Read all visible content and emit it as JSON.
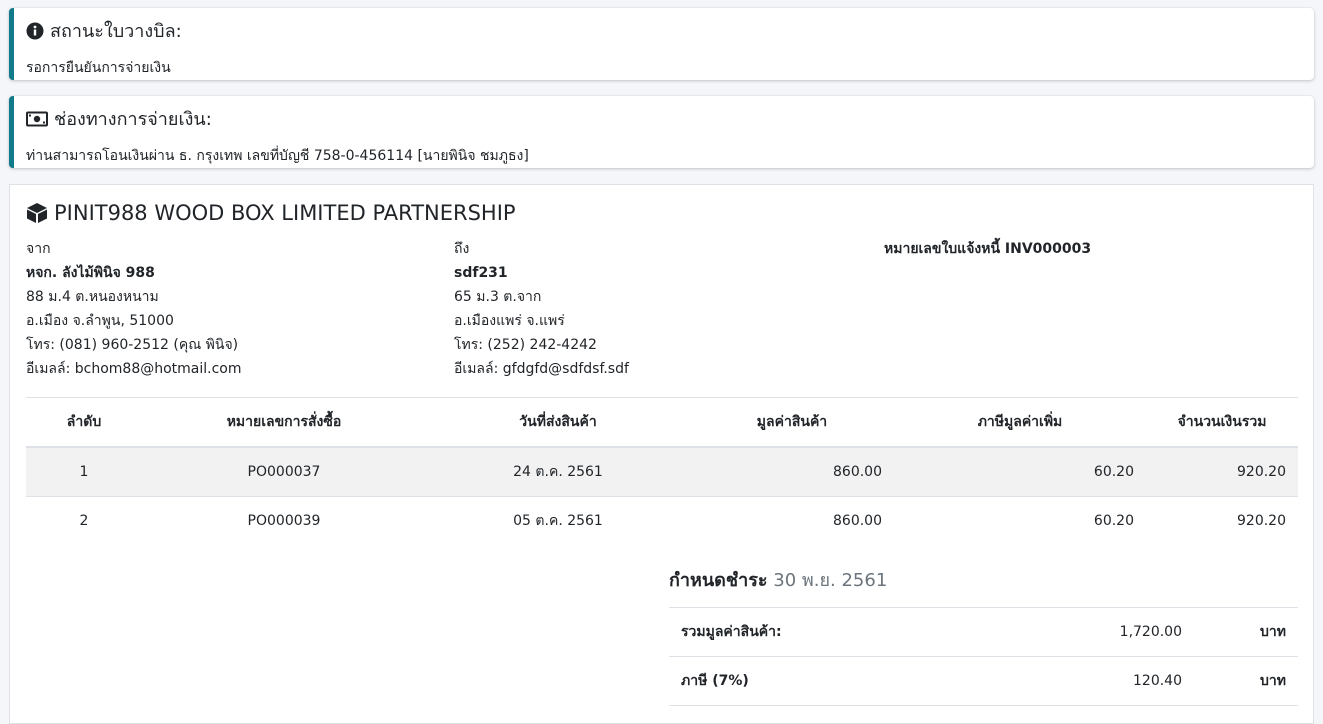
{
  "status": {
    "icon": "info-circle-icon",
    "title": "สถานะใบวางบิล:",
    "text": "รอการยืนยันการจ่ายเงิน"
  },
  "payment": {
    "icon": "money-bill-icon",
    "title": "ช่องทางการจ่ายเงิน:",
    "text": "ท่านสามารถโอนเงินผ่าน ธ. กรุงเทพ เลขที่บัญชี 758-0-456114 [นายพินิจ ชมภูธง]"
  },
  "invoice": {
    "brand_icon": "cube-icon",
    "brand": "PINIT988 WOOD BOX LIMITED PARTNERSHIP",
    "from": {
      "label": "จาก",
      "name": "หจก. ลังไม้พินิจ 988",
      "address1": "88 ม.4 ต.หนองหนาม",
      "address2": "อ.เมือง จ.ลำพูน, 51000",
      "phone": "โทร: (081) 960-2512 (คุณ พินิจ)",
      "email": "อีเมลล์: bchom88@hotmail.com"
    },
    "to": {
      "label": "ถึง",
      "name": "sdf231",
      "address1": "65 ม.3 ต.จาก",
      "address2": "อ.เมืองแพร่ จ.แพร่",
      "phone": "โทร: (252) 242-4242",
      "email": "อีเมลล์: gfdgfd@sdfdsf.sdf"
    },
    "number_label": "หมายเลขใบแจ้งหนี้ INV000003",
    "table": {
      "headers": [
        "ลำดับ",
        "หมายเลขการสั่งซื้อ",
        "วันที่ส่งสินค้า",
        "มูลค่าสินค้า",
        "ภาษีมูลค่าเพิ่ม",
        "จำนวนเงินรวม"
      ],
      "rows": [
        [
          "1",
          "PO000037",
          "24 ต.ค. 2561",
          "860.00",
          "60.20",
          "920.20"
        ],
        [
          "2",
          "PO000039",
          "05 ต.ค. 2561",
          "860.00",
          "60.20",
          "920.20"
        ]
      ]
    },
    "due_label": "กำหนดชำระ",
    "due_date": "30 พ.ย. 2561",
    "summary": [
      {
        "label": "รวมมูลค่าสินค้า:",
        "amount": "1,720.00",
        "unit": "บาท"
      },
      {
        "label": "ภาษี (7%)",
        "amount": "120.40",
        "unit": "บาท"
      }
    ]
  },
  "colors": {
    "callout_border": "#117a8b",
    "stripe": "#f2f2f2"
  }
}
